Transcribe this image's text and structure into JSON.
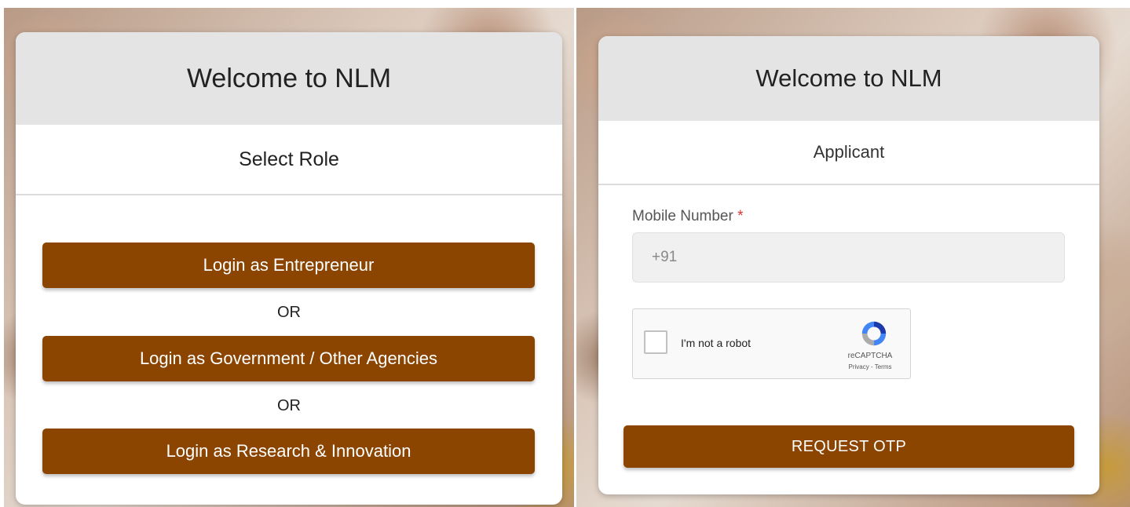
{
  "left_card": {
    "title": "Welcome to NLM",
    "subtitle": "Select Role",
    "buttons": [
      {
        "label": "Login as Entrepreneur"
      },
      {
        "label": "Login as Government / Other Agencies"
      },
      {
        "label": "Login as Research & Innovation"
      }
    ],
    "separators": [
      "OR",
      "OR"
    ]
  },
  "right_card": {
    "title": "Welcome to NLM",
    "subtitle": "Applicant",
    "mobile_label": "Mobile Number",
    "required_marker": "*",
    "mobile_placeholder": "+91",
    "captcha": {
      "label": "I'm not a robot",
      "brand": "reCAPTCHA",
      "links": "Privacy - Terms"
    },
    "submit_label": "REQUEST OTP"
  },
  "colors": {
    "accent": "#8b4500",
    "header_bg": "#e4e4e4"
  }
}
